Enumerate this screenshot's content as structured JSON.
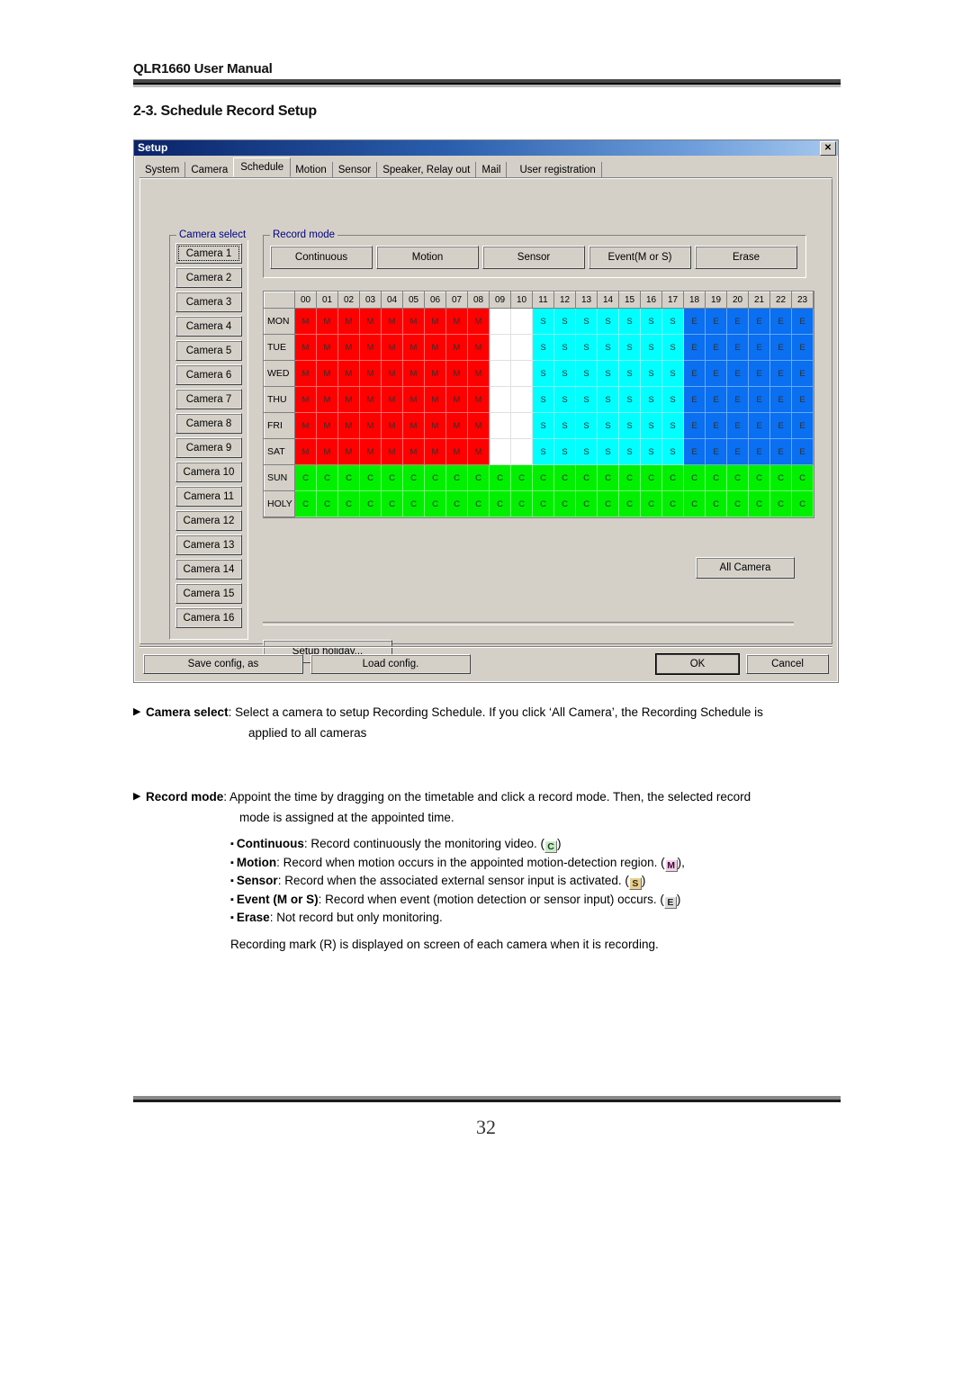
{
  "document": {
    "header_title": "QLR1660 User Manual",
    "section_title": "2-3. Schedule Record Setup",
    "page_number": "32"
  },
  "dialog": {
    "title": "Setup",
    "close_label": "✕",
    "tabs": [
      {
        "label": "System",
        "selected": false
      },
      {
        "label": "Camera",
        "selected": false
      },
      {
        "label": "Schedule",
        "selected": true
      },
      {
        "label": "Motion",
        "selected": false
      },
      {
        "label": "Sensor",
        "selected": false
      },
      {
        "label": "Speaker, Relay out",
        "selected": false
      },
      {
        "label": "Mail",
        "selected": false
      },
      {
        "label": "User registration",
        "selected": false
      }
    ],
    "camera_select": {
      "group_label": "Camera select",
      "selected_index": 0,
      "items": [
        "Camera 1",
        "Camera 2",
        "Camera 3",
        "Camera 4",
        "Camera 5",
        "Camera 6",
        "Camera 7",
        "Camera 8",
        "Camera 9",
        "Camera 10",
        "Camera 11",
        "Camera 12",
        "Camera 13",
        "Camera 14",
        "Camera 15",
        "Camera 16"
      ]
    },
    "record_mode": {
      "group_label": "Record mode",
      "buttons": [
        "Continuous",
        "Motion",
        "Sensor",
        "Event(M or S)",
        "Erase"
      ]
    },
    "schedule": {
      "hours": [
        "00",
        "01",
        "02",
        "03",
        "04",
        "05",
        "06",
        "07",
        "08",
        "09",
        "10",
        "11",
        "12",
        "13",
        "14",
        "15",
        "16",
        "17",
        "18",
        "19",
        "20",
        "21",
        "22",
        "23"
      ],
      "days": [
        "MON",
        "TUE",
        "WED",
        "THU",
        "FRI",
        "SAT",
        "SUN",
        "HOLY"
      ],
      "legend": {
        "M": {
          "label": "Motion",
          "color": "#ff0000"
        },
        "S": {
          "label": "Sensor",
          "color": "#00ffff"
        },
        "E": {
          "label": "Event(M or S)",
          "color": "#0a6ff0"
        },
        "C": {
          "label": "Continuous",
          "color": "#00f000"
        },
        "": {
          "label": "Erase",
          "color": "#ffffff"
        }
      },
      "rows": [
        {
          "day": "MON",
          "cells": [
            "M",
            "M",
            "M",
            "M",
            "M",
            "M",
            "M",
            "M",
            "M",
            "",
            "",
            "S",
            "S",
            "S",
            "S",
            "S",
            "S",
            "S",
            "E",
            "E",
            "E",
            "E",
            "E",
            "E"
          ]
        },
        {
          "day": "TUE",
          "cells": [
            "M",
            "M",
            "M",
            "M",
            "M",
            "M",
            "M",
            "M",
            "M",
            "",
            "",
            "S",
            "S",
            "S",
            "S",
            "S",
            "S",
            "S",
            "E",
            "E",
            "E",
            "E",
            "E",
            "E"
          ]
        },
        {
          "day": "WED",
          "cells": [
            "M",
            "M",
            "M",
            "M",
            "M",
            "M",
            "M",
            "M",
            "M",
            "",
            "",
            "S",
            "S",
            "S",
            "S",
            "S",
            "S",
            "S",
            "E",
            "E",
            "E",
            "E",
            "E",
            "E"
          ]
        },
        {
          "day": "THU",
          "cells": [
            "M",
            "M",
            "M",
            "M",
            "M",
            "M",
            "M",
            "M",
            "M",
            "",
            "",
            "S",
            "S",
            "S",
            "S",
            "S",
            "S",
            "S",
            "E",
            "E",
            "E",
            "E",
            "E",
            "E"
          ]
        },
        {
          "day": "FRI",
          "cells": [
            "M",
            "M",
            "M",
            "M",
            "M",
            "M",
            "M",
            "M",
            "M",
            "",
            "",
            "S",
            "S",
            "S",
            "S",
            "S",
            "S",
            "S",
            "E",
            "E",
            "E",
            "E",
            "E",
            "E"
          ]
        },
        {
          "day": "SAT",
          "cells": [
            "M",
            "M",
            "M",
            "M",
            "M",
            "M",
            "M",
            "M",
            "M",
            "",
            "",
            "S",
            "S",
            "S",
            "S",
            "S",
            "S",
            "S",
            "E",
            "E",
            "E",
            "E",
            "E",
            "E"
          ]
        },
        {
          "day": "SUN",
          "cells": [
            "C",
            "C",
            "C",
            "C",
            "C",
            "C",
            "C",
            "C",
            "C",
            "C",
            "C",
            "C",
            "C",
            "C",
            "C",
            "C",
            "C",
            "C",
            "C",
            "C",
            "C",
            "C",
            "C",
            "C"
          ]
        },
        {
          "day": "HOLY",
          "cells": [
            "C",
            "C",
            "C",
            "C",
            "C",
            "C",
            "C",
            "C",
            "C",
            "C",
            "C",
            "C",
            "C",
            "C",
            "C",
            "C",
            "C",
            "C",
            "C",
            "C",
            "C",
            "C",
            "C",
            "C"
          ]
        }
      ]
    },
    "all_camera_label": "All Camera",
    "setup_holiday_label": "Setup holiday...",
    "footer_buttons": {
      "save": "Save config, as",
      "load": "Load config.",
      "ok": "OK",
      "cancel": "Cancel"
    }
  },
  "notes": {
    "camera_select": {
      "term": "Camera select",
      "line1": ": Select a camera to setup Recording Schedule. If you click ‘All Camera’, the Recording Schedule is",
      "line2": "applied to all cameras"
    },
    "record_mode": {
      "term": "Record mode",
      "line1": ": Appoint the time by dragging on the timetable and click a record mode. Then, the selected record",
      "line2": "mode is assigned at the appointed time."
    },
    "bullets": [
      {
        "term": "Continuous",
        "text": ": Record continuously the monitoring video. (",
        "badge": "C",
        "badge_class": "c",
        "tail": ")"
      },
      {
        "term": "Motion",
        "text": ": Record when motion occurs in the appointed motion-detection region. (",
        "badge": "M",
        "badge_class": "m",
        "tail": "),"
      },
      {
        "term": "Sensor",
        "text": ": Record when the associated external sensor input is activated. (",
        "badge": "S",
        "badge_class": "s",
        "tail": ")"
      },
      {
        "term": "Event (M or S)",
        "text": ": Record when event (motion detection or sensor input) occurs. (",
        "badge": "E",
        "badge_class": "e",
        "tail": ")"
      },
      {
        "term": "Erase",
        "text": ": Not record but only monitoring.",
        "badge": "",
        "badge_class": "",
        "tail": ""
      }
    ],
    "closing": "Recording mark (R) is displayed on screen of each camera when it is recording."
  }
}
